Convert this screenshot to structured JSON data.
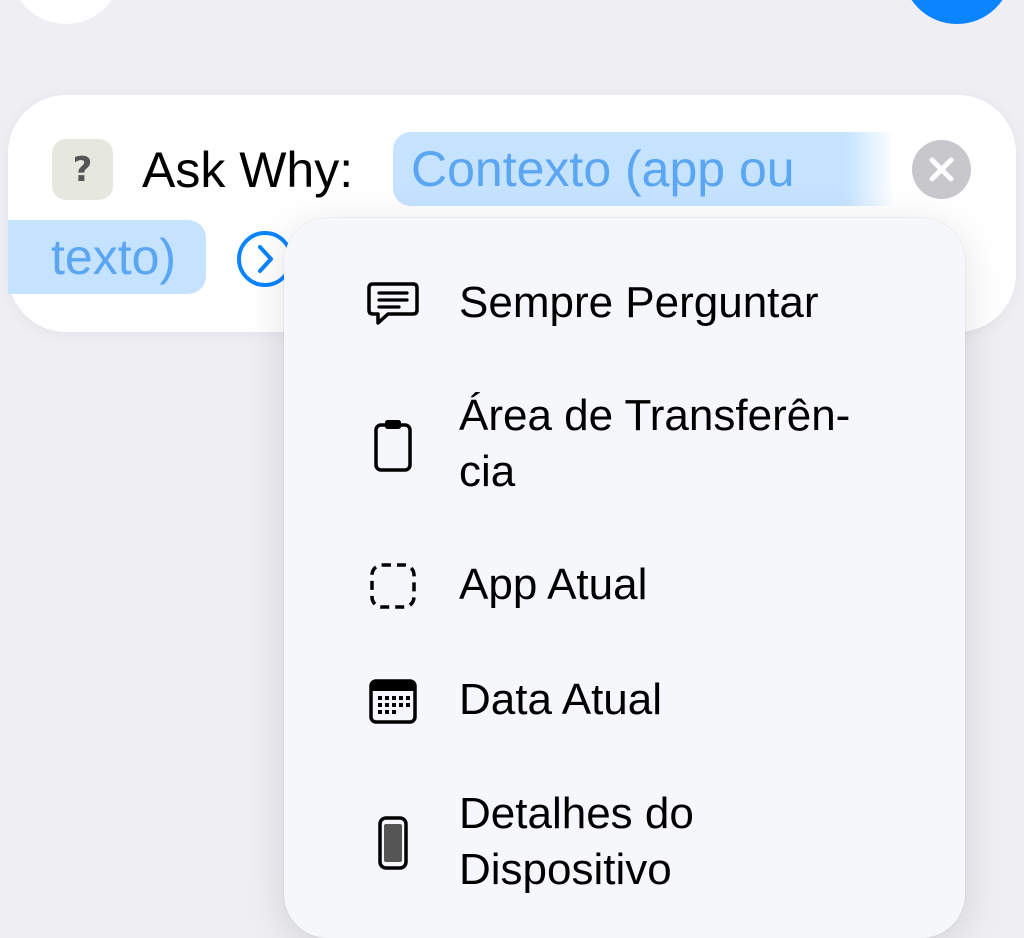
{
  "action": {
    "app_icon_glyph": "?",
    "title": "Ask Why:",
    "param_token_part1": "Contexto (app ou",
    "param_token_part2": "texto)",
    "clear_icon": "xmark-circle-icon",
    "expand_icon": "chevron-right-circle-icon"
  },
  "menu": {
    "items": [
      {
        "label": "Sempre Perguntar",
        "icon": "message-bubble-icon"
      },
      {
        "label": "Área de Transferên-cia",
        "icon": "clipboard-icon"
      },
      {
        "label": "App Atual",
        "icon": "dashed-square-icon"
      },
      {
        "label": "Data Atual",
        "icon": "calendar-icon"
      },
      {
        "label": "Detalhes do Dispositivo",
        "icon": "iphone-icon"
      }
    ]
  },
  "colors": {
    "accent": "#0a84ff",
    "token_background": "#c5e2ff",
    "token_text": "#5aa6f3",
    "page_background": "#eeeef3",
    "menu_background": "#f6f7fa"
  }
}
